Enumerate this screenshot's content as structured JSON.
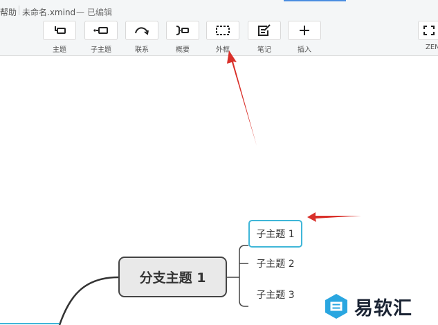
{
  "titlebar": {
    "menu_help": "帮助",
    "filename": "未命名.xmind",
    "status_dash": "—",
    "status": "已编辑"
  },
  "toolbar": {
    "items": [
      {
        "label": "主题",
        "icon": "topic-icon"
      },
      {
        "label": "子主题",
        "icon": "subtopic-icon"
      },
      {
        "label": "联系",
        "icon": "relationship-icon"
      },
      {
        "label": "概要",
        "icon": "summary-icon"
      },
      {
        "label": "外框",
        "icon": "boundary-icon"
      },
      {
        "label": "笔记",
        "icon": "note-icon"
      },
      {
        "label": "插入",
        "icon": "plus-icon"
      },
      {
        "label": "ZEN",
        "icon": "zen-icon"
      }
    ]
  },
  "mindmap": {
    "branch": "分支主题 1",
    "subtopics": [
      "子主题 1",
      "子主题 2",
      "子主题 3"
    ]
  },
  "watermark": {
    "text": "易软汇"
  },
  "colors": {
    "annotation_arrow": "#d9302a",
    "selection": "#3fb6d8",
    "toolbar_bg": "#f4f6f7"
  }
}
